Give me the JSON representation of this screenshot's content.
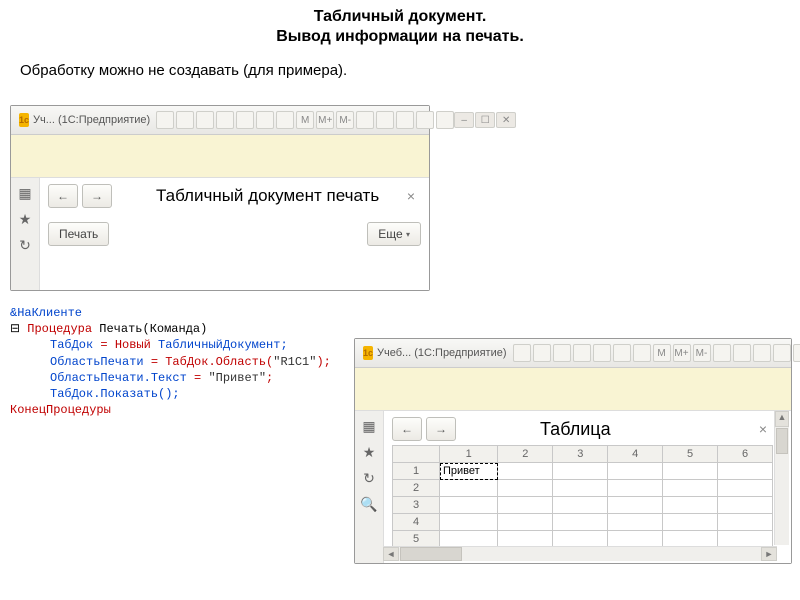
{
  "slide": {
    "title": "Табличный документ.",
    "subtitle": "Вывод информации на печать.",
    "description": "Обработку можно не создавать (для примера)."
  },
  "window1": {
    "title": "Уч... (1С:Предприятие)",
    "tb_icons": [
      "",
      "",
      "",
      "",
      "",
      "",
      "",
      "M",
      "M+",
      "M-",
      "",
      "",
      "",
      "",
      ""
    ],
    "doc_title": "Табличный документ печать",
    "print_label": "Печать",
    "more_label": "Еще"
  },
  "code": {
    "l1": "&НаКлиенте",
    "l2a": "Процедура ",
    "l2b": "Печать",
    "l2c": "(Команда)",
    "l3a": "ТабДок ",
    "l3b": "= Новый ",
    "l3c": "ТабличныйДокумент;",
    "l4a": "ОбластьПечати ",
    "l4b": "= ТабДок.Область(",
    "l4c": "\"R1C1\"",
    "l4d": ");",
    "l5a": "ОбластьПечати.Текст ",
    "l5b": "= ",
    "l5c": "\"Привет\"",
    "l5d": ";",
    "l6": "ТабДок.Показать();",
    "l7": "КонецПроцедуры"
  },
  "window2": {
    "title": "Учеб... (1С:Предприятие)",
    "tb_icons": [
      "",
      "",
      "",
      "",
      "",
      "",
      "",
      "M",
      "M+",
      "M-",
      "",
      "",
      "",
      "",
      ""
    ],
    "doc_title": "Таблица",
    "columns": [
      "1",
      "2",
      "3",
      "4",
      "5",
      "6"
    ],
    "rows": [
      "1",
      "2",
      "3",
      "4",
      "5"
    ],
    "cell_value": "Привет"
  }
}
